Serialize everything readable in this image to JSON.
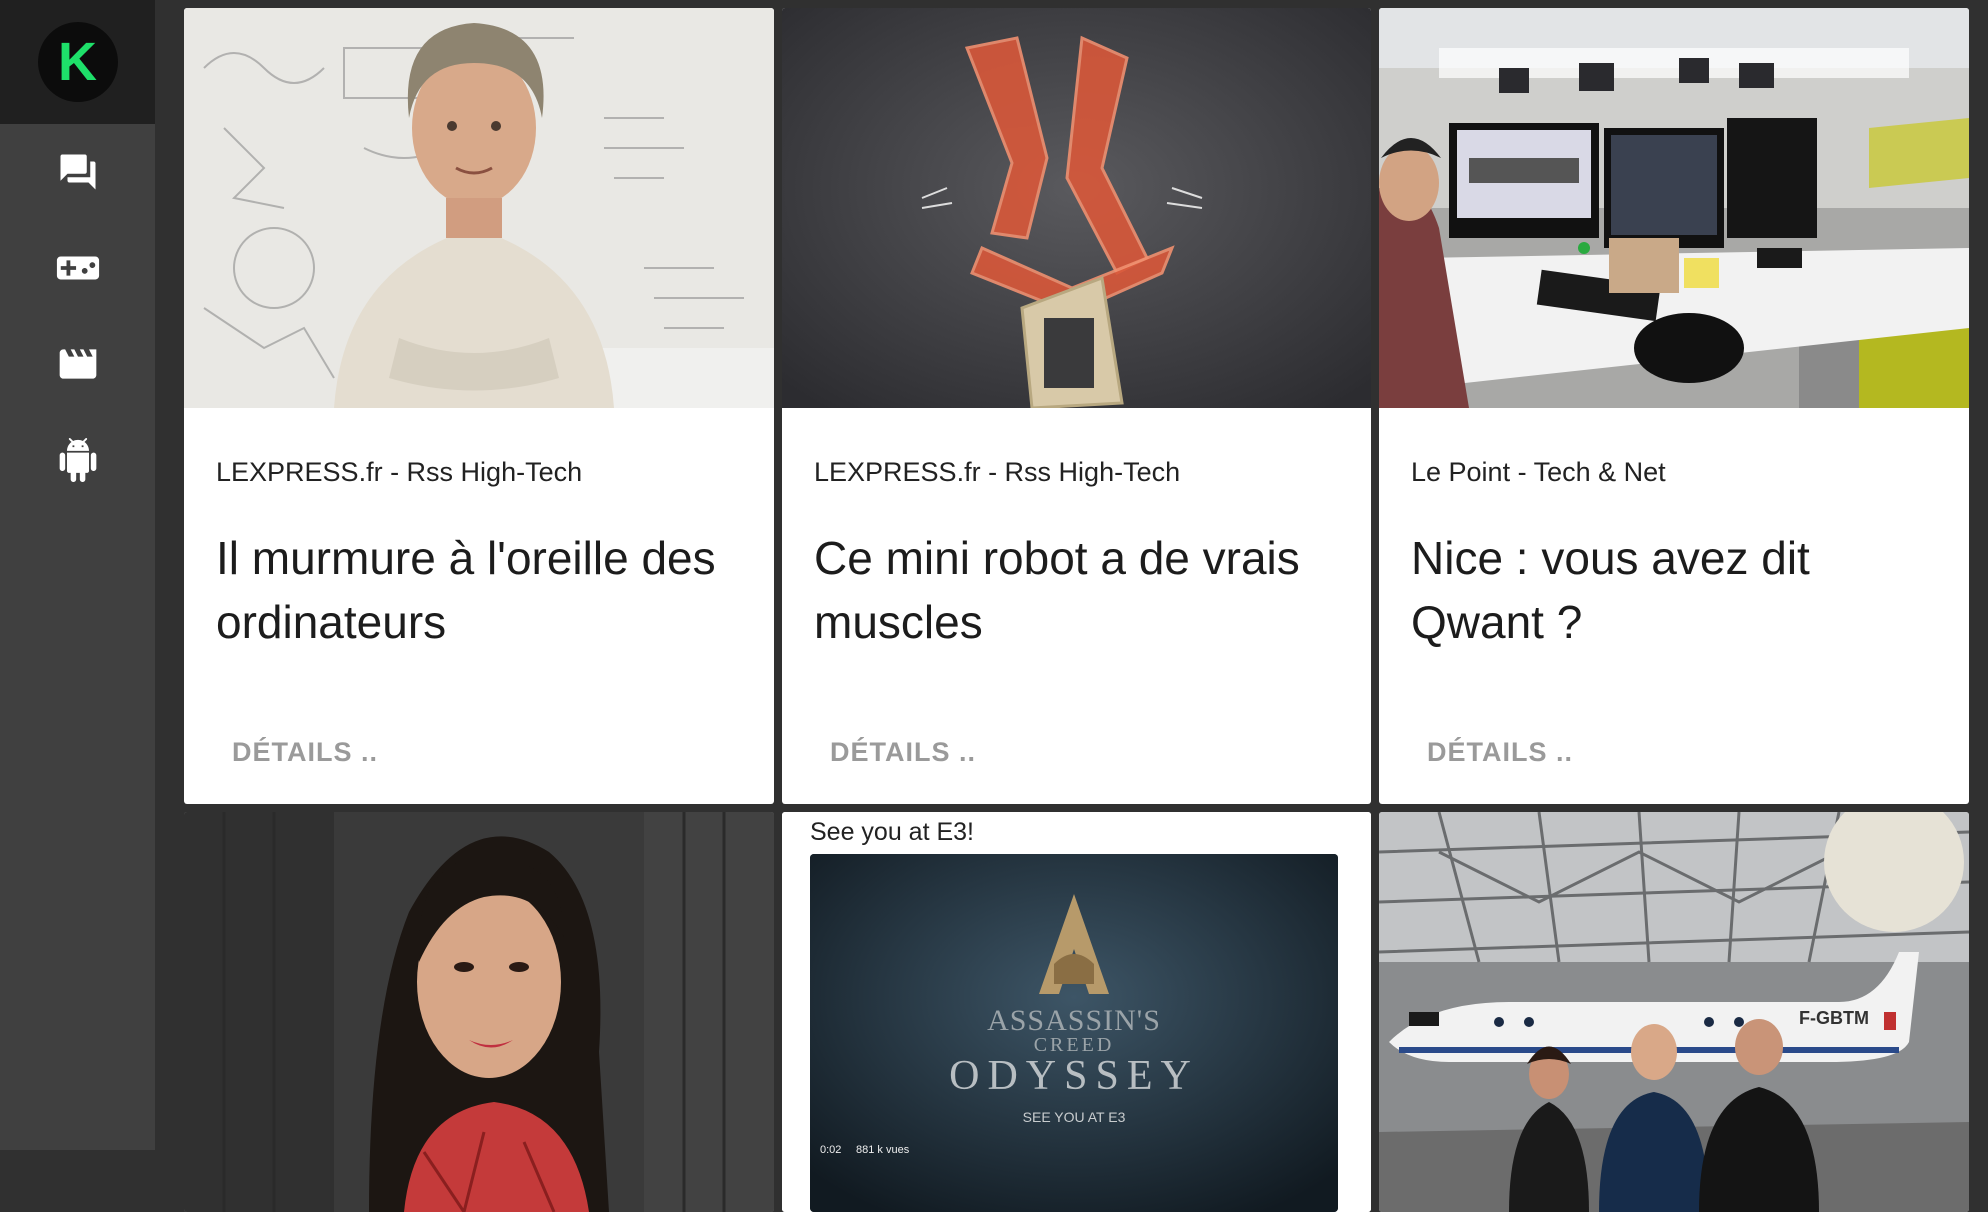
{
  "app": {
    "logo_letter": "K",
    "brand_color": "#1ee06a"
  },
  "sidebar": {
    "items": [
      {
        "icon": "forum-icon"
      },
      {
        "icon": "gamepad-icon"
      },
      {
        "icon": "movie-icon"
      },
      {
        "icon": "android-icon"
      }
    ]
  },
  "cards": [
    {
      "source": "LEXPRESS.fr - Rss High-Tech",
      "title": "Il murmure à l'oreille des ordinateurs",
      "action": "DÉTAILS ..",
      "image": "man-whiteboard-photo"
    },
    {
      "source": "LEXPRESS.fr - Rss High-Tech",
      "title": "Ce mini robot a de vrais muscles",
      "action": "DÉTAILS ..",
      "image": "mini-robot-photo"
    },
    {
      "source": "Le Point - Tech & Net",
      "title": "Nice : vous avez dit Qwant  ?",
      "action": "DÉTAILS ..",
      "image": "office-photo"
    }
  ],
  "bottom_cards": [
    {
      "image": "woman-portrait-photo"
    },
    {
      "image": "assassins-creed-screenshot",
      "caption": "See you at E3!",
      "game_line1": "ASSASSIN'S",
      "game_line2": "CREED",
      "game_line3": "ODYSSEY",
      "game_tag": "SEE YOU AT E3",
      "video_time": "0:02",
      "video_views": "881 k vues"
    },
    {
      "image": "hangar-plane-photo",
      "plane_reg": "F-GBTM"
    }
  ]
}
